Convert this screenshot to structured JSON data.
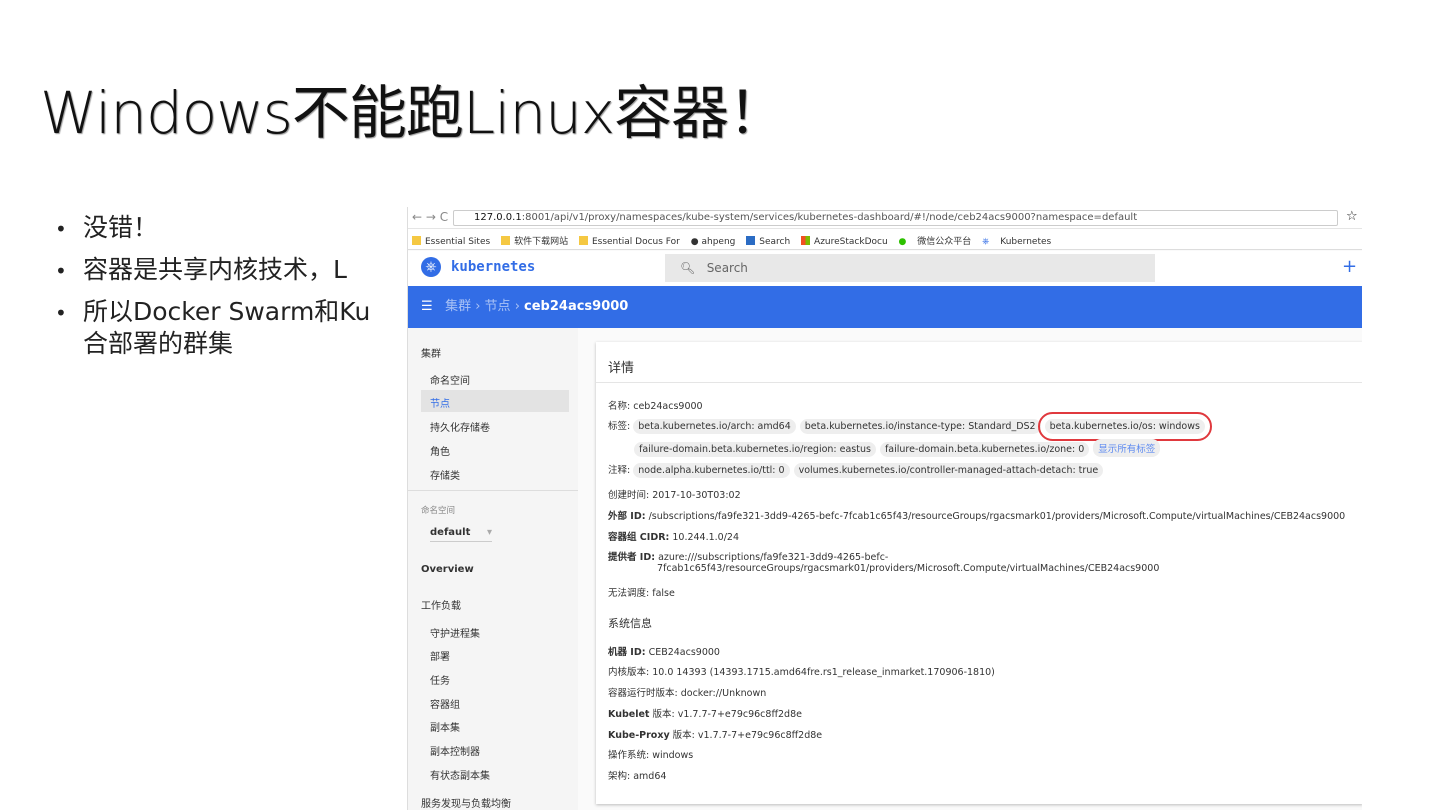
{
  "slide": {
    "title": "Windows不能跑Linux容器！",
    "bullets": [
      "没错！",
      "容器是共享内核技术，L",
      "所以Docker Swarm和Ku",
      "合部署的群集"
    ]
  },
  "browser": {
    "url_host": "127.0.0.1",
    "url_rest": ":8001/api/v1/proxy/namespaces/kube-system/services/kubernetes-dashboard/#!/node/ceb24acs9000?namespace=default",
    "bookmarks": [
      "Essential Sites",
      "软件下载网站",
      "Essential Docus For",
      "ahpeng",
      "Search",
      "AzureStackDocu",
      "微信公众平台",
      "Kubernetes"
    ]
  },
  "app": {
    "brand": "kubernetes",
    "search_placeholder": "Search",
    "add": "+",
    "breadcrumb": [
      "集群",
      "节点",
      "ceb24acs9000"
    ]
  },
  "sidebar": {
    "cluster": "集群",
    "cluster_items": [
      "命名空间",
      "节点",
      "持久化存储卷",
      "角色",
      "存储类"
    ],
    "ns_label": "命名空间",
    "ns_value": "default",
    "overview": "Overview",
    "workloads": "工作负载",
    "workload_items": [
      "守护进程集",
      "部署",
      "任务",
      "容器组",
      "副本集",
      "副本控制器",
      "有状态副本集"
    ],
    "services": "服务发现与负载均衡"
  },
  "details": {
    "heading": "详情",
    "name_label": "名称:",
    "name": "ceb24acs9000",
    "labels_label": "标签:",
    "labels": [
      "beta.kubernetes.io/arch: amd64",
      "beta.kubernetes.io/instance-type: Standard_DS2",
      "beta.kubernetes.io/os: windows",
      "failure-domain.beta.kubernetes.io/region: eastus",
      "failure-domain.beta.kubernetes.io/zone: 0"
    ],
    "show_all": "显示所有标签",
    "annotations_label": "注释:",
    "annotations": [
      "node.alpha.kubernetes.io/ttl: 0",
      "volumes.kubernetes.io/controller-managed-attach-detach: true"
    ],
    "created": "创建时间: 2017-10-30T03:02",
    "external_label": "外部 ID:",
    "external": "/subscriptions/fa9fe321-3dd9-4265-befc-7fcab1c65f43/resourceGroups/rgacsmark01/providers/Microsoft.Compute/virtualMachines/CEB24acs9000",
    "cidr_label": "容器组 CIDR:",
    "cidr": "10.244.1.0/24",
    "provider_label": "提供者 ID:",
    "provider1": "azure:///subscriptions/fa9fe321-3dd9-4265-befc-",
    "provider2": "7fcab1c65f43/resourceGroups/rgacsmark01/providers/Microsoft.Compute/virtualMachines/CEB24acs9000",
    "unschedulable": "无法调度: false"
  },
  "sysinfo": {
    "heading": "系统信息",
    "machine_label": "机器 ID:",
    "machine": "CEB24acs9000",
    "kernel": "内核版本: 10.0 14393 (14393.1715.amd64fre.rs1_release_inmarket.170906-1810)",
    "runtime": "容器运行时版本: docker://Unknown",
    "kubelet_label": "Kubelet",
    "kubelet": "版本: v1.7.7-7+e79c96c8ff2d8e",
    "proxy_label": "Kube-Proxy",
    "proxy": "版本: v1.7.7-7+e79c96c8ff2d8e",
    "os": "操作系统: windows",
    "arch": "架构: amd64"
  }
}
